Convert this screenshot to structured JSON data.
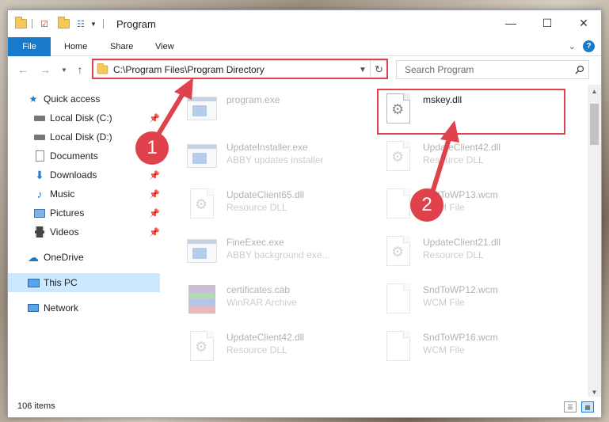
{
  "window": {
    "title": "Program",
    "controls": {
      "minimize": "—",
      "maximize": "☐",
      "close": "✕"
    }
  },
  "ribbon": {
    "file": "File",
    "tabs": [
      "Home",
      "Share",
      "View"
    ],
    "help": "?"
  },
  "nav": {
    "address": "C:\\Program Files\\Program Directory",
    "search_placeholder": "Search Program"
  },
  "sidebar": {
    "items": [
      {
        "label": "Quick access",
        "icon": "star-icon",
        "pinned": false
      },
      {
        "label": "Local Disk (C:)",
        "icon": "drive-icon",
        "pinned": true
      },
      {
        "label": "Local Disk (D:)",
        "icon": "drive-icon",
        "pinned": false
      },
      {
        "label": "Documents",
        "icon": "documents-icon",
        "pinned": true
      },
      {
        "label": "Downloads",
        "icon": "download-icon",
        "pinned": true
      },
      {
        "label": "Music",
        "icon": "music-icon",
        "pinned": true
      },
      {
        "label": "Pictures",
        "icon": "pictures-icon",
        "pinned": true
      },
      {
        "label": "Videos",
        "icon": "videos-icon",
        "pinned": true
      },
      {
        "label": "OneDrive",
        "icon": "cloud-icon",
        "pinned": false
      },
      {
        "label": "This PC",
        "icon": "computer-icon",
        "pinned": false,
        "selected": true
      },
      {
        "label": "Network",
        "icon": "network-icon",
        "pinned": false
      }
    ],
    "pin_glyph": "📌"
  },
  "files": [
    {
      "name": "program.exe",
      "type": "",
      "kind": "exe"
    },
    {
      "name": "mskey.dll",
      "type": "",
      "kind": "dll",
      "highlight": true
    },
    {
      "name": "UpdateInstaller.exe",
      "type": "ABBY updates installer",
      "kind": "exe"
    },
    {
      "name": "UpdateClient42.dll",
      "type": "Resource DLL",
      "kind": "dll"
    },
    {
      "name": "UpdateClient65.dll",
      "type": "Resource DLL",
      "kind": "dll"
    },
    {
      "name": "SndToWP13.wcm",
      "type": "WCM File",
      "kind": "page"
    },
    {
      "name": "FineExec.exe",
      "type": "ABBY background exe...",
      "kind": "exe"
    },
    {
      "name": "UpdateClient21.dll",
      "type": "Resource DLL",
      "kind": "dll"
    },
    {
      "name": "certificates.cab",
      "type": "WinRAR Archive",
      "kind": "rar"
    },
    {
      "name": "SndToWP12.wcm",
      "type": "WCM File",
      "kind": "page"
    },
    {
      "name": "UpdateClient42.dll",
      "type": "Resource DLL",
      "kind": "dll"
    },
    {
      "name": "SndToWP16.wcm",
      "type": "WCM File",
      "kind": "page"
    }
  ],
  "status": {
    "count": "106 items"
  },
  "annotations": {
    "step1": "1",
    "step2": "2"
  },
  "colors": {
    "accent": "#1979ca",
    "annotation": "#e0424c",
    "selected": "#cce8ff"
  }
}
